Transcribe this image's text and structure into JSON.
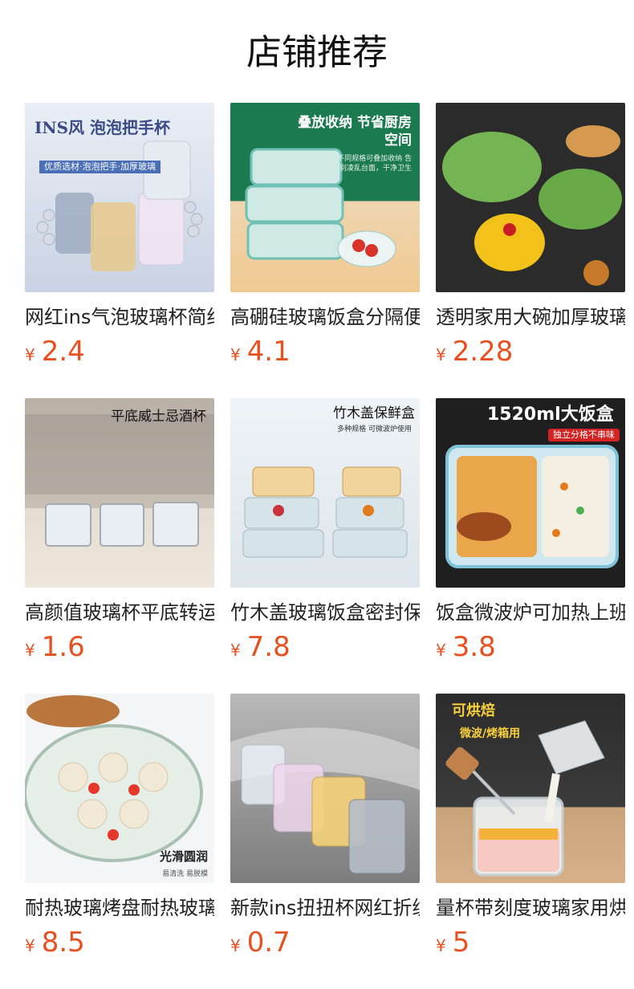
{
  "header": {
    "title": "店铺推荐"
  },
  "colors": {
    "price": "#e9501f"
  },
  "products": [
    {
      "name": "网红ins气泡玻璃杯简约",
      "currency": "¥",
      "price": "2.4",
      "image": {
        "icon": "bubble-handle-glass-cups-photo",
        "caption": "INS风 泡泡把手杯",
        "tagline": "优质选材·泡泡把手·加厚玻璃"
      }
    },
    {
      "name": "高硼硅玻璃饭盒分隔便当盒",
      "currency": "¥",
      "price": "4.1",
      "image": {
        "icon": "glass-lunch-boxes-photo",
        "caption": "叠放收纳 节省厨房空间",
        "tagline": "不同规格可叠加收纳 告别凌乱台面，干净卫生"
      }
    },
    {
      "name": "透明家用大碗加厚玻璃沙拉碗",
      "currency": "¥",
      "price": "2.28",
      "image": {
        "icon": "salad-bowls-photo",
        "caption": "",
        "tagline": ""
      }
    },
    {
      "name": "高颜值玻璃杯平底转运酒杯",
      "currency": "¥",
      "price": "1.6",
      "image": {
        "icon": "whisky-glasses-photo",
        "caption": "平底威士忌酒杯",
        "tagline": ""
      }
    },
    {
      "name": "竹木盖玻璃饭盒密封保鲜盒",
      "currency": "¥",
      "price": "7.8",
      "image": {
        "icon": "bamboo-lid-containers-photo",
        "caption": "竹木盖保鲜盒",
        "tagline": "多种规格 可微波炉使用"
      }
    },
    {
      "name": "饭盒微波炉可加热上班族",
      "currency": "¥",
      "price": "3.8",
      "image": {
        "icon": "1520ml-lunch-box-photo",
        "caption": "1520ml大饭盒",
        "tagline": "独立分格不串味"
      }
    },
    {
      "name": "耐热玻璃烤盘耐热玻璃鱼盘",
      "currency": "¥",
      "price": "8.5",
      "image": {
        "icon": "oval-baking-dish-photo",
        "caption": "光滑圆润",
        "tagline": "易清洗 易脱模"
      }
    },
    {
      "name": "新款ins扭扭杯网红折纹杯",
      "currency": "¥",
      "price": "0.7",
      "image": {
        "icon": "twisted-cups-photo",
        "caption": "",
        "tagline": ""
      }
    },
    {
      "name": "量杯带刻度玻璃家用烘焙",
      "currency": "¥",
      "price": "5",
      "image": {
        "icon": "measuring-cup-photo",
        "caption": "可烘焙",
        "tagline": "微波/烤箱用"
      }
    }
  ]
}
